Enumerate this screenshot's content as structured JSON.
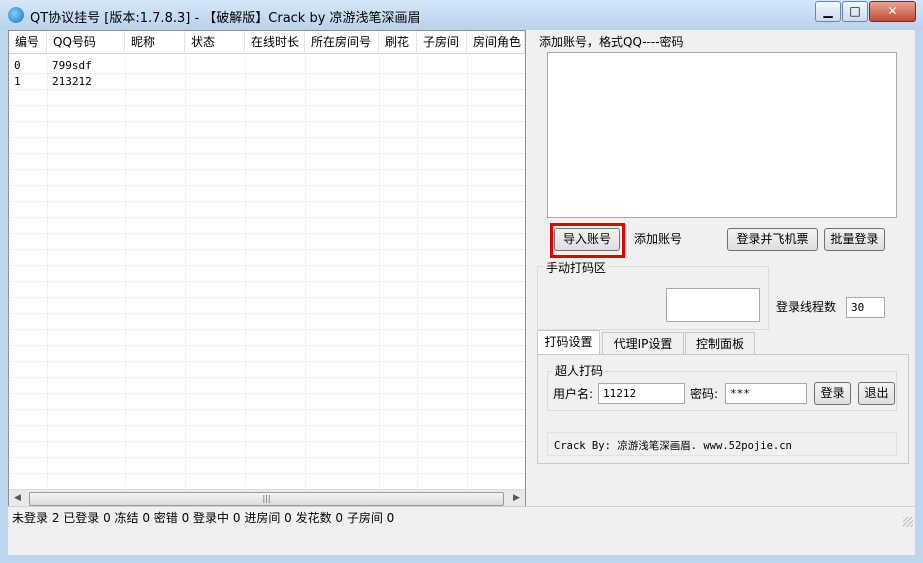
{
  "window": {
    "title": "QT协议挂号 [版本:1.7.8.3] - 【破解版】Crack by 凉游浅笔深画眉",
    "min_glyph": "▁",
    "max_glyph": "□",
    "close_glyph": "✕"
  },
  "table": {
    "columns": [
      "编号",
      "QQ号码",
      "昵称",
      "状态",
      "在线时长",
      "所在房间号",
      "刷花",
      "子房间",
      "房间角色"
    ],
    "rows": [
      {
        "id": "0",
        "qq": "799sdf"
      },
      {
        "id": "1",
        "qq": "213212"
      }
    ],
    "scroll_grip": "|||",
    "scroll_left": "◀",
    "scroll_right": "▶"
  },
  "right": {
    "add_account_label": "添加账号，格式QQ----密码",
    "import_button": "导入账号",
    "add_button": "添加账号",
    "login_ticket_button": "登录并飞机票",
    "batch_login_button": "批量登录",
    "captcha_group_label": "手动打码区",
    "thread_label": "登录线程数",
    "thread_value": "30"
  },
  "tabs": [
    "打码设置",
    "代理IP设置",
    "控制面板"
  ],
  "captcha": {
    "group_label": "超人打码",
    "username_label": "用户名:",
    "username_value": "11212",
    "password_label": "密码:",
    "password_value": "***",
    "login_button": "登录",
    "logout_button": "退出",
    "credit": "Crack By: 凉游浅笔深画眉. www.52pojie.cn"
  },
  "status": {
    "text": "未登录  2  已登录  0  冻结  0  密错  0  登录中  0  进房间  0  发花数  0  子房间  0"
  },
  "colors": {
    "highlight": "#e00000",
    "titlebar": "#b8d2ee",
    "close_button": "#c24a32"
  }
}
